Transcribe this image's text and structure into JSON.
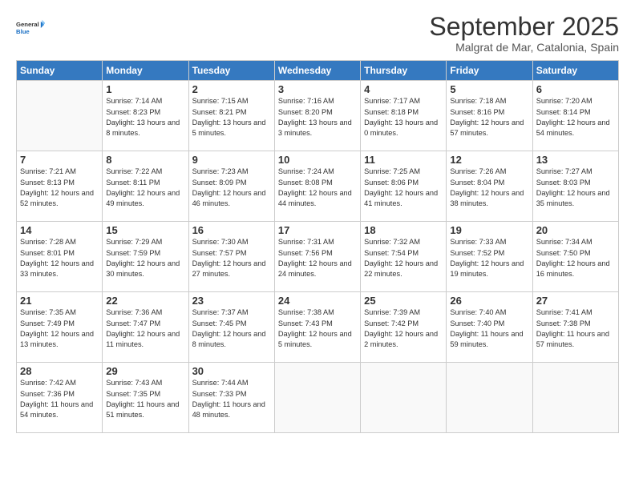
{
  "header": {
    "logo_general": "General",
    "logo_blue": "Blue",
    "month_title": "September 2025",
    "subtitle": "Malgrat de Mar, Catalonia, Spain"
  },
  "days_of_week": [
    "Sunday",
    "Monday",
    "Tuesday",
    "Wednesday",
    "Thursday",
    "Friday",
    "Saturday"
  ],
  "weeks": [
    [
      {
        "day": "",
        "info": ""
      },
      {
        "day": "1",
        "info": "Sunrise: 7:14 AM\nSunset: 8:23 PM\nDaylight: 13 hours\nand 8 minutes."
      },
      {
        "day": "2",
        "info": "Sunrise: 7:15 AM\nSunset: 8:21 PM\nDaylight: 13 hours\nand 5 minutes."
      },
      {
        "day": "3",
        "info": "Sunrise: 7:16 AM\nSunset: 8:20 PM\nDaylight: 13 hours\nand 3 minutes."
      },
      {
        "day": "4",
        "info": "Sunrise: 7:17 AM\nSunset: 8:18 PM\nDaylight: 13 hours\nand 0 minutes."
      },
      {
        "day": "5",
        "info": "Sunrise: 7:18 AM\nSunset: 8:16 PM\nDaylight: 12 hours\nand 57 minutes."
      },
      {
        "day": "6",
        "info": "Sunrise: 7:20 AM\nSunset: 8:14 PM\nDaylight: 12 hours\nand 54 minutes."
      }
    ],
    [
      {
        "day": "7",
        "info": "Sunrise: 7:21 AM\nSunset: 8:13 PM\nDaylight: 12 hours\nand 52 minutes."
      },
      {
        "day": "8",
        "info": "Sunrise: 7:22 AM\nSunset: 8:11 PM\nDaylight: 12 hours\nand 49 minutes."
      },
      {
        "day": "9",
        "info": "Sunrise: 7:23 AM\nSunset: 8:09 PM\nDaylight: 12 hours\nand 46 minutes."
      },
      {
        "day": "10",
        "info": "Sunrise: 7:24 AM\nSunset: 8:08 PM\nDaylight: 12 hours\nand 44 minutes."
      },
      {
        "day": "11",
        "info": "Sunrise: 7:25 AM\nSunset: 8:06 PM\nDaylight: 12 hours\nand 41 minutes."
      },
      {
        "day": "12",
        "info": "Sunrise: 7:26 AM\nSunset: 8:04 PM\nDaylight: 12 hours\nand 38 minutes."
      },
      {
        "day": "13",
        "info": "Sunrise: 7:27 AM\nSunset: 8:03 PM\nDaylight: 12 hours\nand 35 minutes."
      }
    ],
    [
      {
        "day": "14",
        "info": "Sunrise: 7:28 AM\nSunset: 8:01 PM\nDaylight: 12 hours\nand 33 minutes."
      },
      {
        "day": "15",
        "info": "Sunrise: 7:29 AM\nSunset: 7:59 PM\nDaylight: 12 hours\nand 30 minutes."
      },
      {
        "day": "16",
        "info": "Sunrise: 7:30 AM\nSunset: 7:57 PM\nDaylight: 12 hours\nand 27 minutes."
      },
      {
        "day": "17",
        "info": "Sunrise: 7:31 AM\nSunset: 7:56 PM\nDaylight: 12 hours\nand 24 minutes."
      },
      {
        "day": "18",
        "info": "Sunrise: 7:32 AM\nSunset: 7:54 PM\nDaylight: 12 hours\nand 22 minutes."
      },
      {
        "day": "19",
        "info": "Sunrise: 7:33 AM\nSunset: 7:52 PM\nDaylight: 12 hours\nand 19 minutes."
      },
      {
        "day": "20",
        "info": "Sunrise: 7:34 AM\nSunset: 7:50 PM\nDaylight: 12 hours\nand 16 minutes."
      }
    ],
    [
      {
        "day": "21",
        "info": "Sunrise: 7:35 AM\nSunset: 7:49 PM\nDaylight: 12 hours\nand 13 minutes."
      },
      {
        "day": "22",
        "info": "Sunrise: 7:36 AM\nSunset: 7:47 PM\nDaylight: 12 hours\nand 11 minutes."
      },
      {
        "day": "23",
        "info": "Sunrise: 7:37 AM\nSunset: 7:45 PM\nDaylight: 12 hours\nand 8 minutes."
      },
      {
        "day": "24",
        "info": "Sunrise: 7:38 AM\nSunset: 7:43 PM\nDaylight: 12 hours\nand 5 minutes."
      },
      {
        "day": "25",
        "info": "Sunrise: 7:39 AM\nSunset: 7:42 PM\nDaylight: 12 hours\nand 2 minutes."
      },
      {
        "day": "26",
        "info": "Sunrise: 7:40 AM\nSunset: 7:40 PM\nDaylight: 11 hours\nand 59 minutes."
      },
      {
        "day": "27",
        "info": "Sunrise: 7:41 AM\nSunset: 7:38 PM\nDaylight: 11 hours\nand 57 minutes."
      }
    ],
    [
      {
        "day": "28",
        "info": "Sunrise: 7:42 AM\nSunset: 7:36 PM\nDaylight: 11 hours\nand 54 minutes."
      },
      {
        "day": "29",
        "info": "Sunrise: 7:43 AM\nSunset: 7:35 PM\nDaylight: 11 hours\nand 51 minutes."
      },
      {
        "day": "30",
        "info": "Sunrise: 7:44 AM\nSunset: 7:33 PM\nDaylight: 11 hours\nand 48 minutes."
      },
      {
        "day": "",
        "info": ""
      },
      {
        "day": "",
        "info": ""
      },
      {
        "day": "",
        "info": ""
      },
      {
        "day": "",
        "info": ""
      }
    ]
  ]
}
